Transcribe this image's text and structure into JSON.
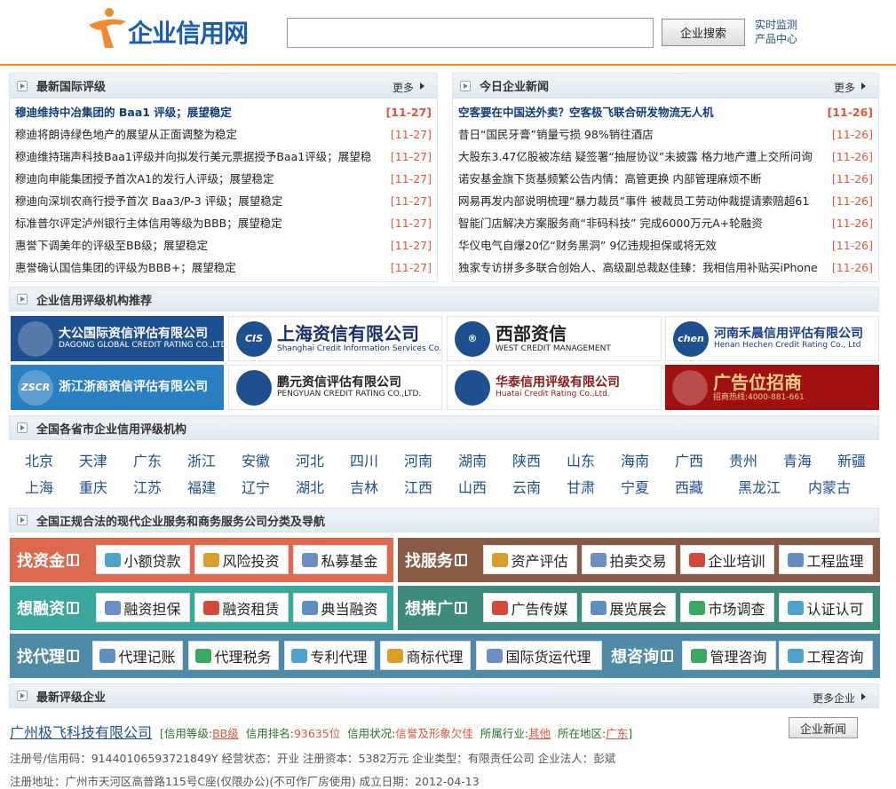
{
  "header": {
    "logo_text": "企业信用网",
    "search_placeholder": "",
    "search_button": "企业搜索",
    "quick_links": [
      "实时监测",
      "产品中心"
    ]
  },
  "intl_ratings": {
    "title": "最新国际评级",
    "more": "更多",
    "items": [
      {
        "title": "穆迪维持中冶集团的 Baa1 评级；展望稳定",
        "date": "[11-27]"
      },
      {
        "title": "穆迪将朗诗绿色地产的展望从正面调整为稳定",
        "date": "[11-27]"
      },
      {
        "title": "穆迪维持瑞声科技Baa1评级并向拟发行美元票据授予Baa1评级；展望稳",
        "date": "[11-27]"
      },
      {
        "title": "穆迪向申能集团授予首次A1的发行人评级；展望稳定",
        "date": "[11-27]"
      },
      {
        "title": "穆迪向深圳农商行授予首次 Baa3/P-3 评级；展望稳定",
        "date": "[11-27]"
      },
      {
        "title": "标准普尔评定泸州银行主体信用等级为BBB；展望稳定",
        "date": "[11-27]"
      },
      {
        "title": "惠誉下调美年的评级至BB级；展望稳定",
        "date": "[11-27]"
      },
      {
        "title": "惠誉确认国信集团的评级为BBB+；展望稳定",
        "date": "[11-27]"
      }
    ]
  },
  "daily_news": {
    "title": "今日企业新闻",
    "more": "更多",
    "items": [
      {
        "title": "空客要在中国送外卖？空客极飞联合研发物流无人机",
        "date": "[11-26]"
      },
      {
        "title": "昔日“国民牙膏”销量亏损 98%销往酒店",
        "date": "[11-26]"
      },
      {
        "title": "大股东3.47亿股被冻结 疑签署“抽屉协议”未披露 格力地产遭上交所问询",
        "date": "[11-26]"
      },
      {
        "title": "诺安基金旗下货基频繁公告内情：高管更换 内部管理麻烦不断",
        "date": "[11-26]"
      },
      {
        "title": "网易再发内部说明梳理“暴力裁员”事件 被裁员工劳动仲裁提请索赔超61",
        "date": "[11-26]"
      },
      {
        "title": "智能门店解决方案服务商“非码科技” 完成6000万元A+轮融资",
        "date": "[11-26]"
      },
      {
        "title": "华仪电气自爆20亿“财务黑洞” 9亿违规担保或将无效",
        "date": "[11-26]"
      },
      {
        "title": "独家专访拼多多联合创始人、高级副总裁赵佳臻：我相信用补贴买iPhone",
        "date": "[11-26]"
      }
    ]
  },
  "agencies": {
    "title": "企业信用评级机构推荐",
    "banners": [
      {
        "name": "大公国际资信评估有限公司",
        "sub": "DAGONG GLOBAL CREDIT RATING CO.,LTD",
        "mark": "",
        "bg": "#1e4f8f",
        "fg": "#ffffff"
      },
      {
        "name": "上海资信有限公司",
        "sub": "Shanghai Credit Information Services Co.,Ltd",
        "mark": "CIS",
        "bg": "#ffffff",
        "fg": "#1a2f6b"
      },
      {
        "name": "西部资信",
        "sub": "WEST CREDIT MANAGEMENT",
        "mark": "®",
        "bg": "#ffffff",
        "fg": "#222222"
      },
      {
        "name": "河南禾晨信用评估有限公司",
        "sub": "Henan Hechen Credit Rating Co., Ltd",
        "mark": "chen",
        "bg": "#ffffff",
        "fg": "#1a3f8a"
      },
      {
        "name": "浙江浙商资信评估有限公司",
        "sub": "",
        "mark": "ZSCR",
        "bg": "#2a7ec2",
        "fg": "#ffffff"
      },
      {
        "name": "鹏元资信评估有限公司",
        "sub": "PENGYUAN CREDIT RATING CO.,LTD.",
        "mark": "",
        "bg": "#ffffff",
        "fg": "#222222"
      },
      {
        "name": "华泰信用评级有限公司",
        "sub": "Huatai Credit Rating Co.,Ltd.",
        "mark": "",
        "bg": "#ffffff",
        "fg": "#8a1a1a"
      },
      {
        "name": "广告位招商",
        "sub": "招商热线:4000-881-661",
        "mark": "",
        "bg": "#a01010",
        "fg": "#f3d08a"
      }
    ]
  },
  "provinces": {
    "title": "全国各省市企业信用评级机构",
    "row1": [
      "北京",
      "天津",
      "广东",
      "浙江",
      "安徽",
      "河北",
      "四川",
      "河南",
      "湖南",
      "陕西",
      "山东",
      "海南",
      "广西",
      "贵州",
      "青海",
      "新疆"
    ],
    "row2": [
      "上海",
      "重庆",
      "江苏",
      "福建",
      "辽宁",
      "湖北",
      "吉林",
      "江西",
      "山西",
      "云南",
      "甘肃",
      "宁夏",
      "西藏",
      "黑龙江",
      "内蒙古"
    ]
  },
  "services": {
    "title": "全国正规合法的现代企业服务和商务服务公司分类及导航",
    "blocks": [
      {
        "label": "找资金",
        "color": "#dd6a4f",
        "items": [
          "小额贷款",
          "风险投资",
          "私募基金"
        ]
      },
      {
        "label": "找服务",
        "color": "#8a5b44",
        "items": [
          "资产评估",
          "拍卖交易",
          "企业培训",
          "工程监理"
        ]
      },
      {
        "label": "想融资",
        "color": "#3aa89c",
        "items": [
          "融资担保",
          "融资租赁",
          "典当融资"
        ]
      },
      {
        "label": "想推广",
        "color": "#3e8a7c",
        "items": [
          "广告传媒",
          "展览展会",
          "市场调查",
          "认证认可"
        ]
      },
      {
        "label": "找代理",
        "color": "#4f8ba7",
        "items": [
          "代理记账",
          "代理税务",
          "专利代理",
          "商标代理",
          "国际货运代理"
        ]
      },
      {
        "label": "想咨询",
        "color": "#4f8ba7",
        "items": [
          "管理咨询",
          "工程咨询"
        ]
      }
    ]
  },
  "latest": {
    "title": "最新评级企业",
    "more": "更多企业",
    "company": "广州极飞科技有限公司",
    "meta": {
      "grade_label": "信用等级:",
      "grade": "BB级",
      "rank_label": "信用排名:",
      "rank": "93635位",
      "status_label": "信用状况:",
      "status": "信誉及形象欠佳",
      "industry_label": "所属行业:",
      "industry": "其他",
      "region_label": "所在地区:",
      "region": "广东"
    },
    "news_button": "企业新闻",
    "info1": "注册号/信用码：91440106593721849Y   经营状态：开业   注册资本：5382万元   企业类型：有限责任公司   企业法人：彭斌",
    "info2": "注册地址：广州市天河区高普路115号C座(仅限办公)(不可作厂房使用)   成立日期：2012-04-13"
  },
  "colors": {
    "accent": "#f08a2e",
    "link": "#1f4f8a",
    "date": "#e4543a"
  }
}
